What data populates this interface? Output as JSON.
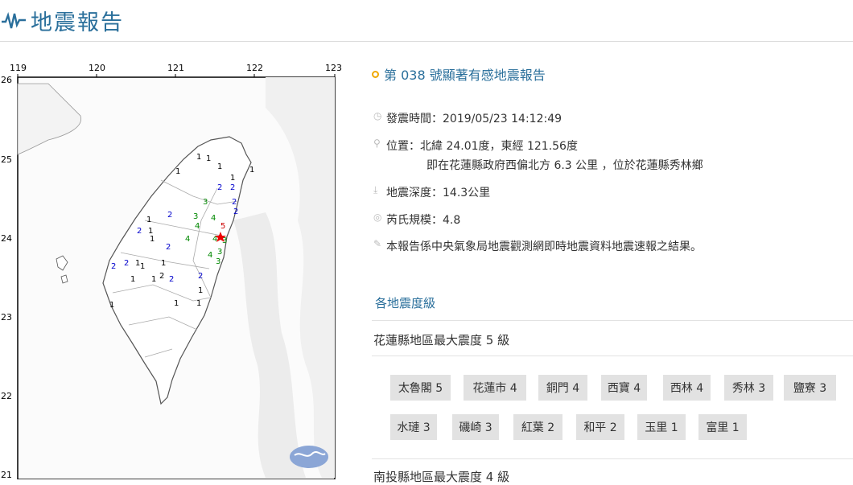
{
  "header": {
    "title": "地震報告"
  },
  "map": {
    "x_ticks": [
      "119",
      "120",
      "121",
      "122",
      "123"
    ],
    "y_ticks": [
      "26",
      "25",
      "24",
      "23",
      "22",
      "21"
    ]
  },
  "report": {
    "title": "第 038 號顯著有感地震報告",
    "time_label": "發震時間：2019/05/23 14:12:49",
    "location_label": "位置：北緯 24.01度，東經 121.56度",
    "location_sub": "即在花蓮縣政府西偏北方 6.3 公里 ，位於花蓮縣秀林鄉",
    "depth_label": "地震深度：14.3公里",
    "magnitude_label": "芮氏規模：4.8",
    "note": "本報告係中央氣象局地震觀測網即時地震資料地震速報之結果。"
  },
  "intensity": {
    "section_title": "各地震度級",
    "county1_title": "花蓮縣地區最大震度 5 級",
    "stations": [
      "太魯閣 5",
      "花蓮市 4",
      "銅門 4",
      "西寶 4",
      "西林 4",
      "秀林 3",
      "鹽寮 3",
      "水璉 3",
      "磯崎 3",
      "紅葉 2",
      "和平 2",
      "玉里 1",
      "富里 1"
    ],
    "county2_title": "南投縣地區最大震度 4 級"
  }
}
